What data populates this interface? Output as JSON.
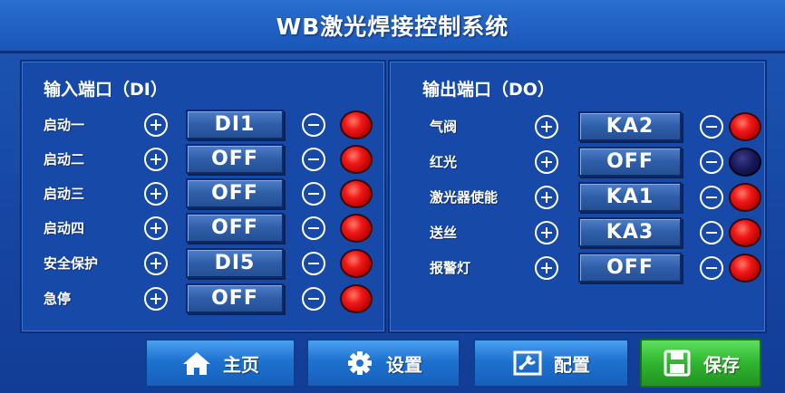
{
  "title": "WB激光焊接控制系统",
  "colors": {
    "lamp_on": "#f01818",
    "lamp_off": "#16165a",
    "nav_blue": "#1e72d0",
    "nav_green": "#2fb52f"
  },
  "di_panel": {
    "header": "输入端口（DI）",
    "rows": [
      {
        "label": "启动一",
        "value": "DI1",
        "lamp": "red"
      },
      {
        "label": "启动二",
        "value": "OFF",
        "lamp": "red"
      },
      {
        "label": "启动三",
        "value": "OFF",
        "lamp": "red"
      },
      {
        "label": "启动四",
        "value": "OFF",
        "lamp": "red"
      },
      {
        "label": "安全保护",
        "value": "DI5",
        "lamp": "red"
      },
      {
        "label": "急停",
        "value": "OFF",
        "lamp": "red"
      }
    ]
  },
  "do_panel": {
    "header": "输出端口（DO）",
    "rows": [
      {
        "label": "气阀",
        "value": "KA2",
        "lamp": "red"
      },
      {
        "label": "红光",
        "value": "OFF",
        "lamp": "dark"
      },
      {
        "label": "激光器使能",
        "value": "KA1",
        "lamp": "red"
      },
      {
        "label": "送丝",
        "value": "KA3",
        "lamp": "red"
      },
      {
        "label": "报警灯",
        "value": "OFF",
        "lamp": "red"
      }
    ]
  },
  "nav": {
    "home": {
      "label": "主页",
      "icon": "home-icon"
    },
    "settings": {
      "label": "设置",
      "icon": "gear-icon"
    },
    "config": {
      "label": "配置",
      "icon": "config-tool-icon"
    },
    "save": {
      "label": "保存",
      "icon": "save-disk-icon"
    }
  }
}
